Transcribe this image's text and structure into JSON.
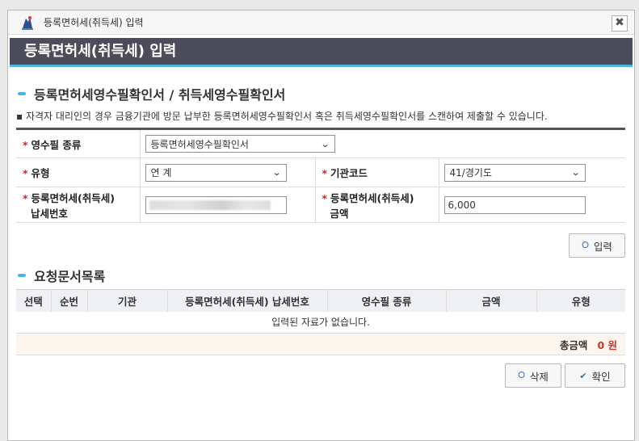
{
  "window": {
    "title": "등록면허세(취득세) 입력",
    "close_glyph": "✖"
  },
  "header": {
    "title": "등록면허세(취득세) 입력"
  },
  "section1": {
    "title": "등록면허세영수필확인서 / 취득세영수필확인서",
    "note": "▪ 자격자 대리인의 경우 금융기관에 방문 납부한 등록면허세영수필확인서 혹은 취득세영수필확인서를 스캔하여 제출할 수 있습니다."
  },
  "form": {
    "required_mark": "*",
    "receipt_type_label": "영수필 종류",
    "receipt_type_value": "등록면허세영수필확인서",
    "category_label": "유형",
    "category_value": "연 계",
    "agency_code_label": "기관코드",
    "agency_code_value": "41/경기도",
    "tax_number_label_1": "등록면허세(취득세)",
    "tax_number_label_2": "납세번호",
    "amount_label_1": "등록면허세(취득세)",
    "amount_label_2": "금액",
    "amount_value": "6,000"
  },
  "input_button": {
    "label": "입력",
    "icon": "circle-icon"
  },
  "section2": {
    "title": "요청문서목록"
  },
  "list": {
    "columns": [
      "선택",
      "순번",
      "기관",
      "등록면허세(취득세) 납세번호",
      "영수필 종류",
      "금액",
      "유형"
    ],
    "empty_message": "입력된 자료가 없습니다.",
    "total_label": "총금액",
    "total_value": "0 원"
  },
  "actions": {
    "delete_label": "삭제",
    "confirm_label": "확인"
  },
  "colors": {
    "header_bg": "#4d4c5a",
    "accent": "#4fb4e0",
    "required": "#d0252a",
    "total_amount": "#c0392b"
  }
}
